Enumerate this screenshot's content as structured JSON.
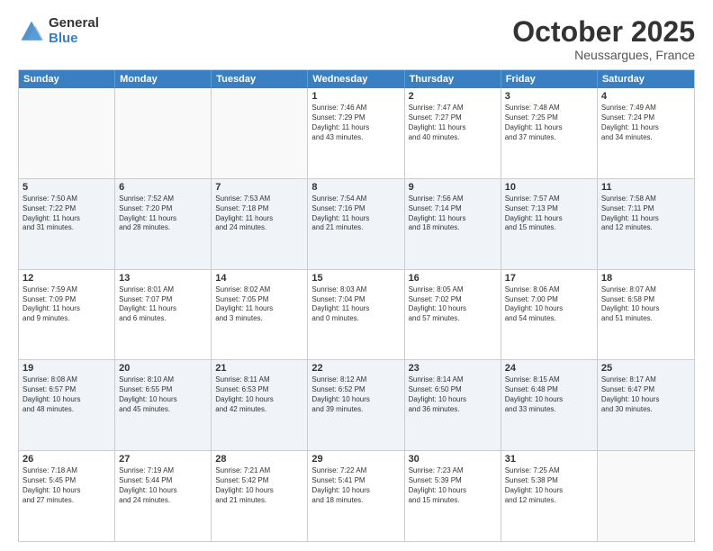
{
  "logo": {
    "general": "General",
    "blue": "Blue"
  },
  "header": {
    "month": "October 2025",
    "location": "Neussargues, France"
  },
  "weekdays": [
    "Sunday",
    "Monday",
    "Tuesday",
    "Wednesday",
    "Thursday",
    "Friday",
    "Saturday"
  ],
  "rows": [
    [
      {
        "day": "",
        "info": ""
      },
      {
        "day": "",
        "info": ""
      },
      {
        "day": "",
        "info": ""
      },
      {
        "day": "1",
        "info": "Sunrise: 7:46 AM\nSunset: 7:29 PM\nDaylight: 11 hours\nand 43 minutes."
      },
      {
        "day": "2",
        "info": "Sunrise: 7:47 AM\nSunset: 7:27 PM\nDaylight: 11 hours\nand 40 minutes."
      },
      {
        "day": "3",
        "info": "Sunrise: 7:48 AM\nSunset: 7:25 PM\nDaylight: 11 hours\nand 37 minutes."
      },
      {
        "day": "4",
        "info": "Sunrise: 7:49 AM\nSunset: 7:24 PM\nDaylight: 11 hours\nand 34 minutes."
      }
    ],
    [
      {
        "day": "5",
        "info": "Sunrise: 7:50 AM\nSunset: 7:22 PM\nDaylight: 11 hours\nand 31 minutes."
      },
      {
        "day": "6",
        "info": "Sunrise: 7:52 AM\nSunset: 7:20 PM\nDaylight: 11 hours\nand 28 minutes."
      },
      {
        "day": "7",
        "info": "Sunrise: 7:53 AM\nSunset: 7:18 PM\nDaylight: 11 hours\nand 24 minutes."
      },
      {
        "day": "8",
        "info": "Sunrise: 7:54 AM\nSunset: 7:16 PM\nDaylight: 11 hours\nand 21 minutes."
      },
      {
        "day": "9",
        "info": "Sunrise: 7:56 AM\nSunset: 7:14 PM\nDaylight: 11 hours\nand 18 minutes."
      },
      {
        "day": "10",
        "info": "Sunrise: 7:57 AM\nSunset: 7:13 PM\nDaylight: 11 hours\nand 15 minutes."
      },
      {
        "day": "11",
        "info": "Sunrise: 7:58 AM\nSunset: 7:11 PM\nDaylight: 11 hours\nand 12 minutes."
      }
    ],
    [
      {
        "day": "12",
        "info": "Sunrise: 7:59 AM\nSunset: 7:09 PM\nDaylight: 11 hours\nand 9 minutes."
      },
      {
        "day": "13",
        "info": "Sunrise: 8:01 AM\nSunset: 7:07 PM\nDaylight: 11 hours\nand 6 minutes."
      },
      {
        "day": "14",
        "info": "Sunrise: 8:02 AM\nSunset: 7:05 PM\nDaylight: 11 hours\nand 3 minutes."
      },
      {
        "day": "15",
        "info": "Sunrise: 8:03 AM\nSunset: 7:04 PM\nDaylight: 11 hours\nand 0 minutes."
      },
      {
        "day": "16",
        "info": "Sunrise: 8:05 AM\nSunset: 7:02 PM\nDaylight: 10 hours\nand 57 minutes."
      },
      {
        "day": "17",
        "info": "Sunrise: 8:06 AM\nSunset: 7:00 PM\nDaylight: 10 hours\nand 54 minutes."
      },
      {
        "day": "18",
        "info": "Sunrise: 8:07 AM\nSunset: 6:58 PM\nDaylight: 10 hours\nand 51 minutes."
      }
    ],
    [
      {
        "day": "19",
        "info": "Sunrise: 8:08 AM\nSunset: 6:57 PM\nDaylight: 10 hours\nand 48 minutes."
      },
      {
        "day": "20",
        "info": "Sunrise: 8:10 AM\nSunset: 6:55 PM\nDaylight: 10 hours\nand 45 minutes."
      },
      {
        "day": "21",
        "info": "Sunrise: 8:11 AM\nSunset: 6:53 PM\nDaylight: 10 hours\nand 42 minutes."
      },
      {
        "day": "22",
        "info": "Sunrise: 8:12 AM\nSunset: 6:52 PM\nDaylight: 10 hours\nand 39 minutes."
      },
      {
        "day": "23",
        "info": "Sunrise: 8:14 AM\nSunset: 6:50 PM\nDaylight: 10 hours\nand 36 minutes."
      },
      {
        "day": "24",
        "info": "Sunrise: 8:15 AM\nSunset: 6:48 PM\nDaylight: 10 hours\nand 33 minutes."
      },
      {
        "day": "25",
        "info": "Sunrise: 8:17 AM\nSunset: 6:47 PM\nDaylight: 10 hours\nand 30 minutes."
      }
    ],
    [
      {
        "day": "26",
        "info": "Sunrise: 7:18 AM\nSunset: 5:45 PM\nDaylight: 10 hours\nand 27 minutes."
      },
      {
        "day": "27",
        "info": "Sunrise: 7:19 AM\nSunset: 5:44 PM\nDaylight: 10 hours\nand 24 minutes."
      },
      {
        "day": "28",
        "info": "Sunrise: 7:21 AM\nSunset: 5:42 PM\nDaylight: 10 hours\nand 21 minutes."
      },
      {
        "day": "29",
        "info": "Sunrise: 7:22 AM\nSunset: 5:41 PM\nDaylight: 10 hours\nand 18 minutes."
      },
      {
        "day": "30",
        "info": "Sunrise: 7:23 AM\nSunset: 5:39 PM\nDaylight: 10 hours\nand 15 minutes."
      },
      {
        "day": "31",
        "info": "Sunrise: 7:25 AM\nSunset: 5:38 PM\nDaylight: 10 hours\nand 12 minutes."
      },
      {
        "day": "",
        "info": ""
      }
    ]
  ]
}
